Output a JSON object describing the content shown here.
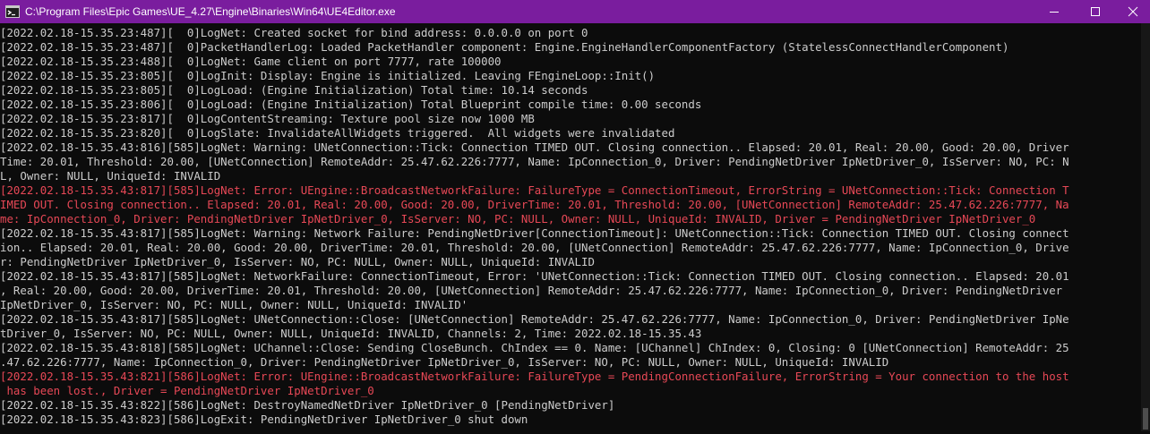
{
  "window": {
    "title": "C:\\Program Files\\Epic Games\\UE_4.27\\Engine\\Binaries\\Win64\\UE4Editor.exe",
    "icon": "console-icon",
    "controls": [
      "minimize-icon",
      "maximize-icon",
      "close-icon"
    ]
  },
  "colors": {
    "titlebar": "#7a1d9e",
    "background": "#0c0c0c",
    "text": "#cccccc",
    "error": "#e74856"
  },
  "log": [
    {
      "kind": "info",
      "text": "[2022.02.18-15.35.23:487][  0]LogNet: Created socket for bind address: 0.0.0.0 on port 0"
    },
    {
      "kind": "info",
      "text": "[2022.02.18-15.35.23:487][  0]PacketHandlerLog: Loaded PacketHandler component: Engine.EngineHandlerComponentFactory (StatelessConnectHandlerComponent)"
    },
    {
      "kind": "info",
      "text": "[2022.02.18-15.35.23:488][  0]LogNet: Game client on port 7777, rate 100000"
    },
    {
      "kind": "info",
      "text": "[2022.02.18-15.35.23:805][  0]LogInit: Display: Engine is initialized. Leaving FEngineLoop::Init()"
    },
    {
      "kind": "info",
      "text": "[2022.02.18-15.35.23:805][  0]LogLoad: (Engine Initialization) Total time: 10.14 seconds"
    },
    {
      "kind": "info",
      "text": "[2022.02.18-15.35.23:806][  0]LogLoad: (Engine Initialization) Total Blueprint compile time: 0.00 seconds"
    },
    {
      "kind": "info",
      "text": "[2022.02.18-15.35.23:817][  0]LogContentStreaming: Texture pool size now 1000 MB"
    },
    {
      "kind": "info",
      "text": "[2022.02.18-15.35.23:820][  0]LogSlate: InvalidateAllWidgets triggered.  All widgets were invalidated"
    },
    {
      "kind": "warn",
      "text": "[2022.02.18-15.35.43:816][585]LogNet: Warning: UNetConnection::Tick: Connection TIMED OUT. Closing connection.. Elapsed: 20.01, Real: 20.00, Good: 20.00, Driver"
    },
    {
      "kind": "warn",
      "text": "Time: 20.01, Threshold: 20.00, [UNetConnection] RemoteAddr: 25.47.62.226:7777, Name: IpConnection_0, Driver: PendingNetDriver IpNetDriver_0, IsServer: NO, PC: N"
    },
    {
      "kind": "warn",
      "text": "L, Owner: NULL, UniqueId: INVALID"
    },
    {
      "kind": "err",
      "text": "[2022.02.18-15.35.43:817][585]LogNet: Error: UEngine::BroadcastNetworkFailure: FailureType = ConnectionTimeout, ErrorString = UNetConnection::Tick: Connection T"
    },
    {
      "kind": "err",
      "text": "IMED OUT. Closing connection.. Elapsed: 20.01, Real: 20.00, Good: 20.00, DriverTime: 20.01, Threshold: 20.00, [UNetConnection] RemoteAddr: 25.47.62.226:7777, Na"
    },
    {
      "kind": "err",
      "text": "me: IpConnection_0, Driver: PendingNetDriver IpNetDriver_0, IsServer: NO, PC: NULL, Owner: NULL, UniqueId: INVALID, Driver = PendingNetDriver IpNetDriver_0"
    },
    {
      "kind": "warn",
      "text": "[2022.02.18-15.35.43:817][585]LogNet: Warning: Network Failure: PendingNetDriver[ConnectionTimeout]: UNetConnection::Tick: Connection TIMED OUT. Closing connect"
    },
    {
      "kind": "warn",
      "text": "ion.. Elapsed: 20.01, Real: 20.00, Good: 20.00, DriverTime: 20.01, Threshold: 20.00, [UNetConnection] RemoteAddr: 25.47.62.226:7777, Name: IpConnection_0, Drive"
    },
    {
      "kind": "warn",
      "text": "r: PendingNetDriver IpNetDriver_0, IsServer: NO, PC: NULL, Owner: NULL, UniqueId: INVALID"
    },
    {
      "kind": "info",
      "text": "[2022.02.18-15.35.43:817][585]LogNet: NetworkFailure: ConnectionTimeout, Error: 'UNetConnection::Tick: Connection TIMED OUT. Closing connection.. Elapsed: 20.01"
    },
    {
      "kind": "info",
      "text": ", Real: 20.00, Good: 20.00, DriverTime: 20.01, Threshold: 20.00, [UNetConnection] RemoteAddr: 25.47.62.226:7777, Name: IpConnection_0, Driver: PendingNetDriver"
    },
    {
      "kind": "info",
      "text": "IpNetDriver_0, IsServer: NO, PC: NULL, Owner: NULL, UniqueId: INVALID'"
    },
    {
      "kind": "info",
      "text": "[2022.02.18-15.35.43:817][585]LogNet: UNetConnection::Close: [UNetConnection] RemoteAddr: 25.47.62.226:7777, Name: IpConnection_0, Driver: PendingNetDriver IpNe"
    },
    {
      "kind": "info",
      "text": "tDriver_0, IsServer: NO, PC: NULL, Owner: NULL, UniqueId: INVALID, Channels: 2, Time: 2022.02.18-15.35.43"
    },
    {
      "kind": "info",
      "text": "[2022.02.18-15.35.43:818][585]LogNet: UChannel::Close: Sending CloseBunch. ChIndex == 0. Name: [UChannel] ChIndex: 0, Closing: 0 [UNetConnection] RemoteAddr: 25"
    },
    {
      "kind": "info",
      "text": ".47.62.226:7777, Name: IpConnection_0, Driver: PendingNetDriver IpNetDriver_0, IsServer: NO, PC: NULL, Owner: NULL, UniqueId: INVALID"
    },
    {
      "kind": "err",
      "text": "[2022.02.18-15.35.43:821][586]LogNet: Error: UEngine::BroadcastNetworkFailure: FailureType = PendingConnectionFailure, ErrorString = Your connection to the host"
    },
    {
      "kind": "err",
      "text": " has been lost., Driver = PendingNetDriver IpNetDriver_0"
    },
    {
      "kind": "info",
      "text": "[2022.02.18-15.35.43:822][586]LogNet: DestroyNamedNetDriver IpNetDriver_0 [PendingNetDriver]"
    },
    {
      "kind": "info",
      "text": "[2022.02.18-15.35.43:823][586]LogExit: PendingNetDriver IpNetDriver_0 shut down"
    }
  ]
}
